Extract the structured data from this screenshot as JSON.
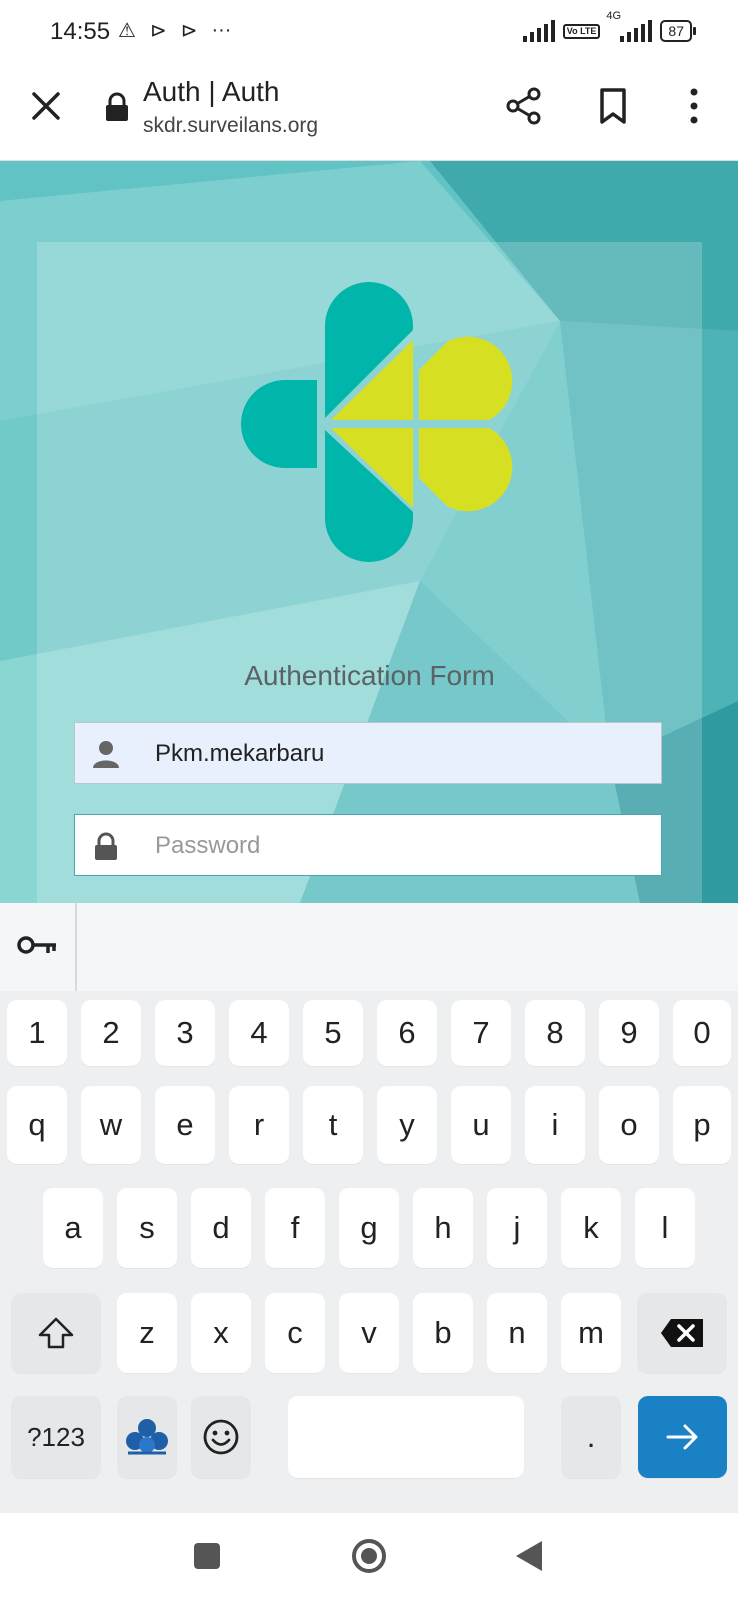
{
  "status_bar": {
    "time": "14:55",
    "network_label": "4G",
    "volte_label": "Vo LTE",
    "battery": "87",
    "icons": [
      "alert-icon",
      "play-icon",
      "play-icon",
      "more-dots-icon",
      "signal-icon",
      "volte-icon",
      "signal-4g-icon",
      "battery-icon"
    ]
  },
  "browser": {
    "title": "Auth | Auth",
    "url": "skdr.surveilans.org",
    "icons": [
      "close-icon",
      "lock-icon",
      "share-icon",
      "bookmark-icon",
      "overflow-menu-icon"
    ]
  },
  "page": {
    "form_title": "Authentication Form",
    "username": {
      "value": "Pkm.mekarbaru",
      "icon": "user-icon"
    },
    "password": {
      "placeholder": "Password",
      "value": "",
      "icon": "lock-icon"
    },
    "colors": {
      "logo_teal": "#00b5a9",
      "logo_yellow": "#d7df23",
      "background": "#5fc1c3"
    }
  },
  "keyboard": {
    "row_numbers": [
      "1",
      "2",
      "3",
      "4",
      "5",
      "6",
      "7",
      "8",
      "9",
      "0"
    ],
    "row_1": [
      "q",
      "w",
      "e",
      "r",
      "t",
      "y",
      "u",
      "i",
      "o",
      "p"
    ],
    "row_2": [
      "a",
      "s",
      "d",
      "f",
      "g",
      "h",
      "j",
      "k",
      "l"
    ],
    "row_3": [
      "z",
      "x",
      "c",
      "v",
      "b",
      "n",
      "m"
    ],
    "symbols_label": "?123",
    "period": ".",
    "icons": [
      "password-key-icon",
      "shift-icon",
      "backspace-icon",
      "keyboard-theme-icon",
      "emoji-icon",
      "enter-arrow-icon"
    ],
    "enter_color": "#1a82c4"
  },
  "nav_bar": {
    "icons": [
      "recent-apps-icon",
      "home-icon",
      "back-icon"
    ]
  }
}
